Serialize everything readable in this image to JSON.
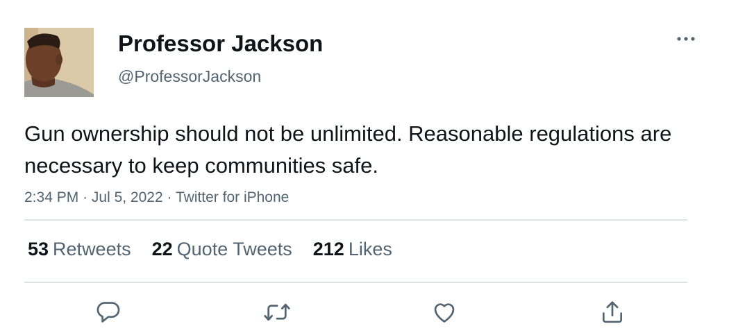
{
  "author": {
    "name": "Professor Jackson",
    "handle": "@ProfessorJackson"
  },
  "tweet": {
    "text": "Gun ownership should not be unlimited. Reasonable regulations are necessary to keep communities safe.",
    "time": "2:34 PM",
    "date": "Jul 5, 2022",
    "source": "Twitter for iPhone",
    "separator": "·"
  },
  "stats": {
    "retweets_count": "53",
    "retweets_label": "Retweets",
    "quotes_count": "22",
    "quotes_label": "Quote Tweets",
    "likes_count": "212",
    "likes_label": "Likes"
  },
  "icons": {
    "more": "more-icon",
    "reply": "reply-icon",
    "retweet": "retweet-icon",
    "like": "like-icon",
    "share": "share-icon"
  },
  "colors": {
    "text_primary": "#0f1419",
    "text_secondary": "#536471",
    "divider": "#dfe3e6",
    "icon": "#536471"
  }
}
